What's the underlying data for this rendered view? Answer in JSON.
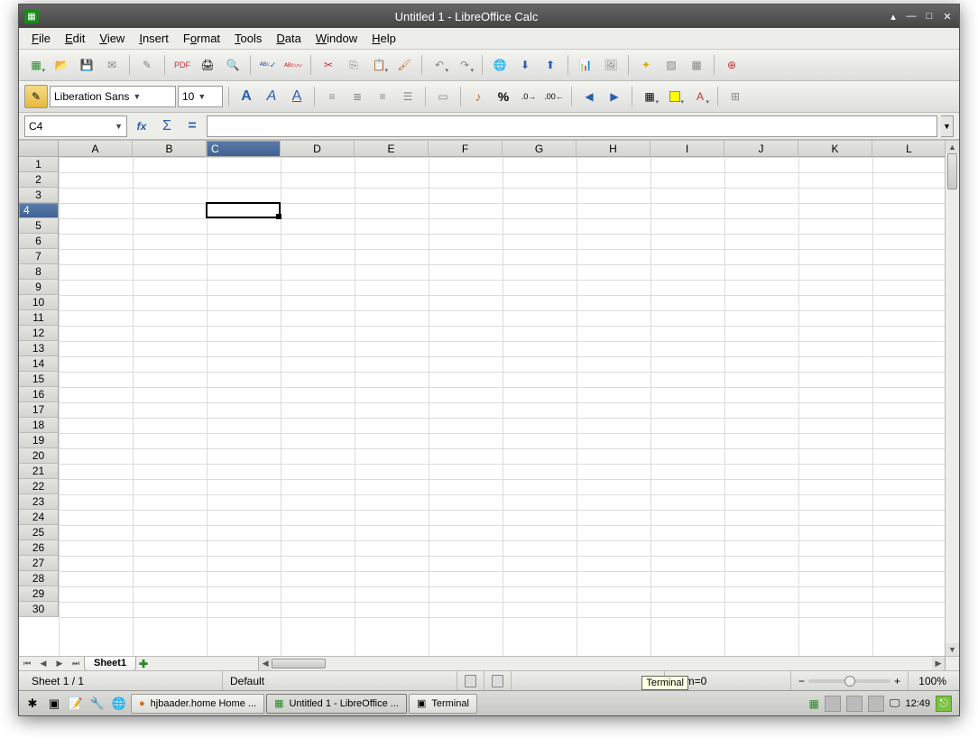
{
  "window": {
    "title": "Untitled 1 - LibreOffice Calc"
  },
  "menu": {
    "file": "File",
    "edit": "Edit",
    "view": "View",
    "insert": "Insert",
    "format": "Format",
    "tools": "Tools",
    "data": "Data",
    "window": "Window",
    "help": "Help"
  },
  "toolbar1": {
    "new": "new-document",
    "open": "open",
    "save": "save",
    "email": "email",
    "edit": "edit-file",
    "pdf": "export-pdf",
    "print": "print",
    "preview": "print-preview",
    "spellauto": "spellcheck-auto",
    "spell": "spellcheck",
    "cut": "cut",
    "copy": "copy",
    "paste": "paste",
    "fmtpaint": "format-paintbrush",
    "undo": "undo",
    "redo": "redo",
    "hyperlink": "hyperlink",
    "sortasc": "sort-ascending",
    "sortdesc": "sort-descending",
    "chart": "insert-chart",
    "gallery": "gallery",
    "star": "extension",
    "img1": "picture",
    "img2": "show-draw",
    "help": "help"
  },
  "toolbar2": {
    "styles": "styles",
    "font": "Liberation Sans",
    "size": "10",
    "bold": "A",
    "italic": "A",
    "underline": "A",
    "al": "align-left",
    "ac": "align-center",
    "ar": "align-right",
    "aj": "align-justify",
    "merge": "merge-cells",
    "currency": "currency",
    "percent": "%",
    "dec_add": ".00",
    "dec_rem": ".00",
    "indent_dec": "decrease-indent",
    "indent_inc": "increase-indent",
    "borders": "borders",
    "bgcolor": "background-color",
    "fontcolor": "font-color",
    "grid": "grid"
  },
  "formula": {
    "cellref": "C4",
    "fx_wizard": "fx",
    "sum": "Σ",
    "equals": "=",
    "input": ""
  },
  "grid": {
    "columns": [
      "A",
      "B",
      "C",
      "D",
      "E",
      "F",
      "G",
      "H",
      "I",
      "J",
      "K",
      "L"
    ],
    "rows": [
      "1",
      "2",
      "3",
      "4",
      "5",
      "6",
      "7",
      "8",
      "9",
      "10",
      "11",
      "12",
      "13",
      "14",
      "15",
      "16",
      "17",
      "18",
      "19",
      "20",
      "21",
      "22",
      "23",
      "24",
      "25",
      "26",
      "27",
      "28",
      "29",
      "30"
    ],
    "selected_col": "C",
    "selected_row": "4",
    "sheet_tab": "Sheet1"
  },
  "status": {
    "sheet": "Sheet 1 / 1",
    "style": "Default",
    "sum": "Sum=0",
    "zoom": "100%"
  },
  "taskbar": {
    "task1": "hjbaader.home Home ...",
    "task2": "Untitled 1 - LibreOffice ...",
    "task3": "Terminal",
    "tooltip": "Terminal",
    "clock": "12:49"
  }
}
